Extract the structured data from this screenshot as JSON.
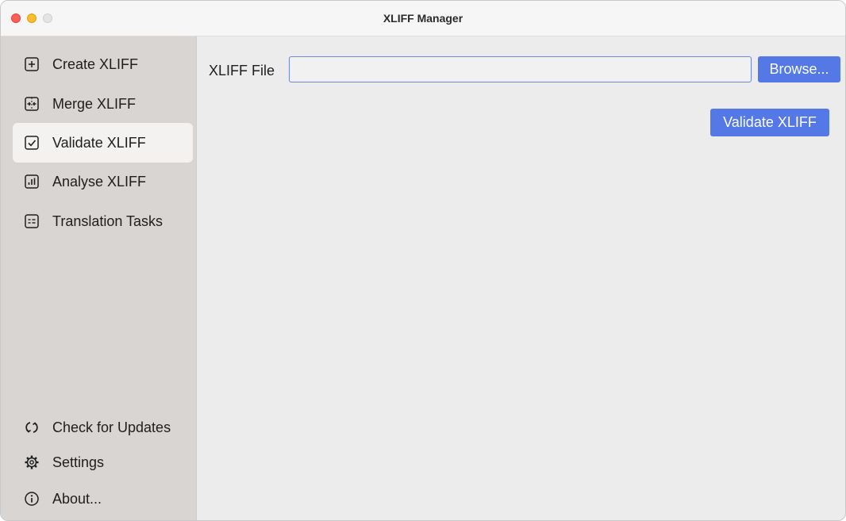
{
  "window": {
    "title": "XLIFF Manager"
  },
  "sidebar": {
    "items": [
      {
        "label": "Create XLIFF",
        "icon": "plus-square-icon"
      },
      {
        "label": "Merge XLIFF",
        "icon": "merge-icon"
      },
      {
        "label": "Validate XLIFF",
        "icon": "check-square-icon",
        "active": true
      },
      {
        "label": "Analyse XLIFF",
        "icon": "bar-chart-icon"
      },
      {
        "label": "Translation Tasks",
        "icon": "task-list-icon"
      }
    ],
    "bottom_items": [
      {
        "label": "Check for Updates",
        "icon": "refresh-icon"
      },
      {
        "label": "Settings",
        "icon": "gear-icon"
      },
      {
        "label": "About...",
        "icon": "info-icon"
      }
    ]
  },
  "main": {
    "file_label": "XLIFF File",
    "file_value": "",
    "browse_label": "Browse...",
    "validate_label": "Validate XLIFF"
  },
  "colors": {
    "accent": "#5478e6",
    "sidebar_bg": "#d8d5d3",
    "content_bg": "#ececec",
    "active_item_bg": "#f3f2f1"
  }
}
